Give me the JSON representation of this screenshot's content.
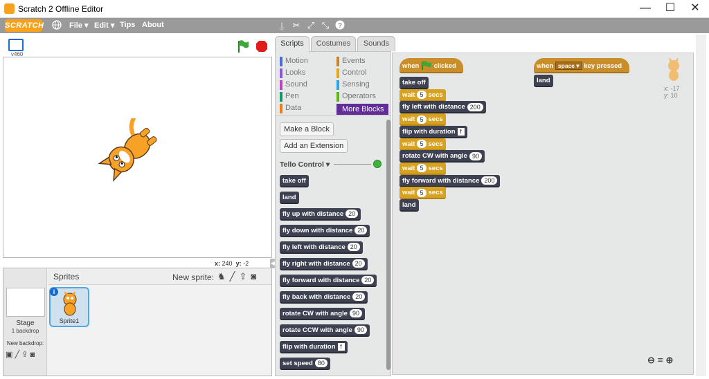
{
  "window": {
    "title": "Scratch 2 Offline Editor",
    "minimize": "—",
    "maximize": "☐",
    "close": "✕"
  },
  "menubar": {
    "logo": "SCRATCH",
    "items": [
      "File",
      "Edit",
      "Tips",
      "About"
    ]
  },
  "stage": {
    "version": "v460",
    "x_label": "x:",
    "x_value": "240",
    "y_label": "y:",
    "y_value": "-2"
  },
  "sprites": {
    "header": "Sprites",
    "new_sprite_label": "New sprite:",
    "stage_label": "Stage",
    "stage_backdrops": "1 backdrop",
    "new_backdrop_label": "New backdrop:",
    "sprite1_name": "Sprite1"
  },
  "tabs": [
    "Scripts",
    "Costumes",
    "Sounds"
  ],
  "categories": {
    "left": [
      {
        "label": "Motion",
        "color": "#4a6cd4"
      },
      {
        "label": "Looks",
        "color": "#8a55d7"
      },
      {
        "label": "Sound",
        "color": "#bb42c3"
      },
      {
        "label": "Pen",
        "color": "#0e9a6c"
      },
      {
        "label": "Data",
        "color": "#ee7d16"
      }
    ],
    "right": [
      {
        "label": "Events",
        "color": "#c88330"
      },
      {
        "label": "Control",
        "color": "#e1a91a"
      },
      {
        "label": "Sensing",
        "color": "#2ca5e2"
      },
      {
        "label": "Operators",
        "color": "#5cb712"
      },
      {
        "label": "More Blocks",
        "color": "#632d99"
      }
    ]
  },
  "palette": {
    "make_block": "Make a Block",
    "add_extension": "Add an Extension",
    "extension_name": "Tello Control",
    "blocks": [
      {
        "text": "take off"
      },
      {
        "text": "land"
      },
      {
        "text": "fly up with distance",
        "arg": "20"
      },
      {
        "text": "fly down with distance",
        "arg": "20"
      },
      {
        "text": "fly left with distance",
        "arg": "20"
      },
      {
        "text": "fly right with distance",
        "arg": "20"
      },
      {
        "text": "fly forward with distance",
        "arg": "20"
      },
      {
        "text": "fly back with distance",
        "arg": "20"
      },
      {
        "text": "rotate CW with angle",
        "arg": "90"
      },
      {
        "text": "rotate CCW with angle",
        "arg": "90"
      },
      {
        "text": "flip with duration",
        "arg": "f",
        "square": true
      },
      {
        "text": "set speed",
        "arg": "80"
      }
    ]
  },
  "script1": {
    "hat_when": "when",
    "hat_clicked": "clicked",
    "blocks": [
      {
        "text": "take off",
        "kind": "dark"
      },
      {
        "text": "wait",
        "arg": "5",
        "suffix": "secs",
        "kind": "ctl"
      },
      {
        "text": "fly left with distance",
        "arg": "200",
        "kind": "dark"
      },
      {
        "text": "wait",
        "arg": "5",
        "suffix": "secs",
        "kind": "ctl"
      },
      {
        "text": "flip with duration",
        "arg": "f",
        "kind": "dark",
        "square": true
      },
      {
        "text": "wait",
        "arg": "5",
        "suffix": "secs",
        "kind": "ctl"
      },
      {
        "text": "rotate CW with angle",
        "arg": "90",
        "kind": "dark"
      },
      {
        "text": "wait",
        "arg": "5",
        "suffix": "secs",
        "kind": "ctl"
      },
      {
        "text": "fly forward with distance",
        "arg": "200",
        "kind": "dark"
      },
      {
        "text": "wait",
        "arg": "5",
        "suffix": "secs",
        "kind": "ctl"
      },
      {
        "text": "land",
        "kind": "dark"
      }
    ]
  },
  "script2": {
    "hat_when": "when",
    "key": "space",
    "hat_suffix": "key pressed",
    "block": "land"
  },
  "sprite_info": {
    "x": "x: -17",
    "y": "y: 10"
  }
}
